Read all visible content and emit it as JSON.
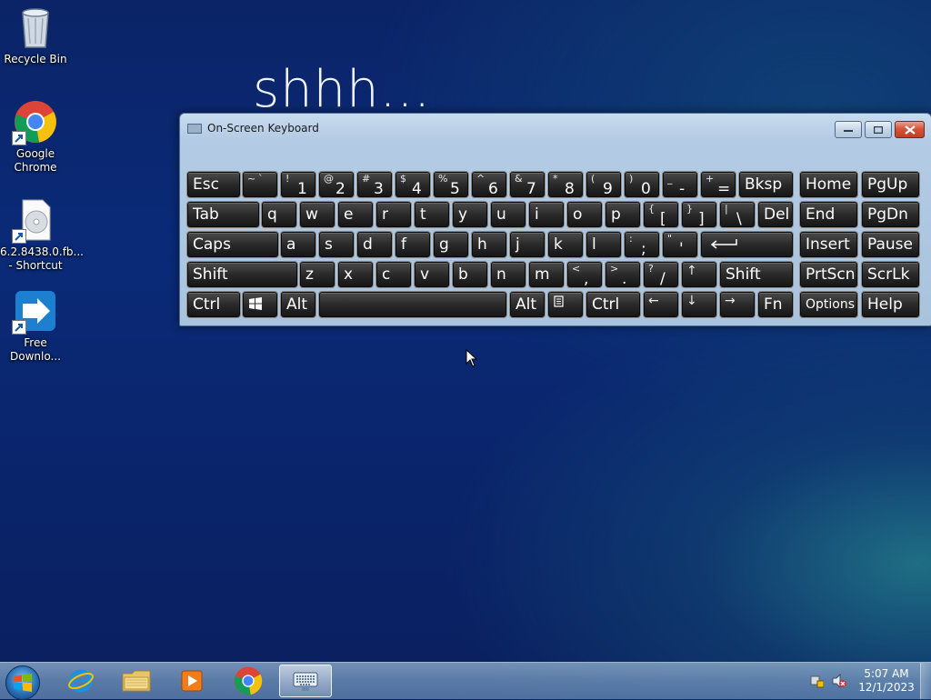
{
  "desktop": {
    "icons": [
      {
        "label": "Recycle Bin",
        "icon": "recycle-bin-icon"
      },
      {
        "label": "Google Chrome",
        "icon": "chrome-icon"
      },
      {
        "label": "6.2.8438.0.fb... - Shortcut",
        "icon": "disc-file-icon"
      },
      {
        "label": "Free Downlo...",
        "icon": "download-manager-icon"
      }
    ],
    "wallpaper_text": "shhh..."
  },
  "osk": {
    "title": "On-Screen Keyboard",
    "rows": {
      "r1": {
        "esc": "Esc",
        "tilde_top": "~",
        "tilde_bot": "`",
        "k1_top": "!",
        "k1": "1",
        "k2_top": "@",
        "k2": "2",
        "k3_top": "#",
        "k3": "3",
        "k4_top": "$",
        "k4": "4",
        "k5_top": "%",
        "k5": "5",
        "k6_top": "^",
        "k6": "6",
        "k7_top": "&",
        "k7": "7",
        "k8_top": "*",
        "k8": "8",
        "k9_top": "(",
        "k9": "9",
        "k0_top": ")",
        "k0": "0",
        "minus_top": "_",
        "minus": "-",
        "eq_top": "+",
        "eq": "=",
        "bksp": "Bksp",
        "home": "Home",
        "pgup": "PgUp"
      },
      "r2": {
        "tab": "Tab",
        "q": "q",
        "w": "w",
        "e": "e",
        "r": "r",
        "t": "t",
        "y": "y",
        "u": "u",
        "i": "i",
        "o": "o",
        "p": "p",
        "lb_top": "{",
        "lb": "[",
        "rb_top": "}",
        "rb": "]",
        "bs_top": "|",
        "bs": "\\",
        "del": "Del",
        "end": "End",
        "pgdn": "PgDn"
      },
      "r3": {
        "caps": "Caps",
        "a": "a",
        "s": "s",
        "d": "d",
        "f": "f",
        "g": "g",
        "h": "h",
        "j": "j",
        "k": "k",
        "l": "l",
        "semi_top": ":",
        "semi": ";",
        "quote_top": "\"",
        "quote": "'",
        "insert": "Insert",
        "pause": "Pause"
      },
      "r4": {
        "lshift": "Shift",
        "z": "z",
        "x": "x",
        "c": "c",
        "v": "v",
        "b": "b",
        "n": "n",
        "m": "m",
        "comma_top": "<",
        "comma": ",",
        "period_top": ">",
        "period": ".",
        "slash_top": "?",
        "slash": "/",
        "up": "↑",
        "rshift": "Shift",
        "prtscn": "PrtScn",
        "scrlk": "ScrLk"
      },
      "r5": {
        "lctrl": "Ctrl",
        "lalt": "Alt",
        "ralt": "Alt",
        "rctrl": "Ctrl",
        "left": "←",
        "down": "↓",
        "right": "→",
        "fn": "Fn",
        "options": "Options",
        "help": "Help"
      }
    }
  },
  "taskbar": {
    "pinned": [
      "start-button",
      "internet-explorer",
      "windows-explorer",
      "media-player",
      "google-chrome",
      "on-screen-keyboard"
    ],
    "clock_time": "5:07 AM",
    "clock_date": "12/1/2023"
  }
}
